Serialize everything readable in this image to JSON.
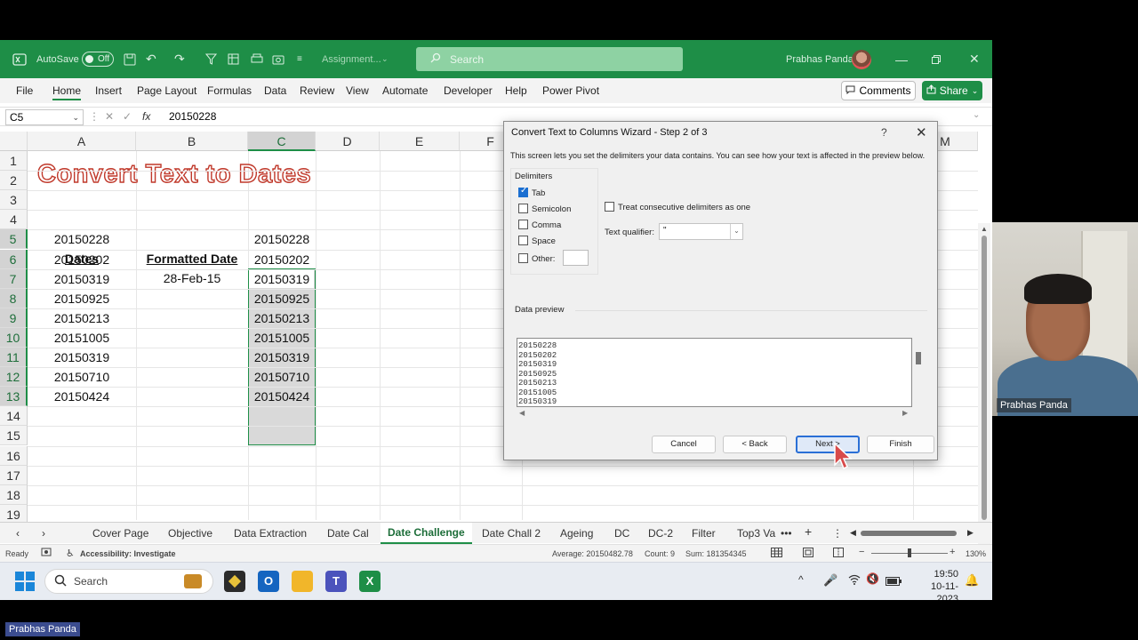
{
  "titlebar": {
    "autosave_label": "AutoSave",
    "autosave_state": "Off",
    "doc_name": "Assignment...",
    "search_placeholder": "Search",
    "user_name": "Prabhas Panda"
  },
  "menu": {
    "items": [
      "File",
      "Home",
      "Insert",
      "Page Layout",
      "Formulas",
      "Data",
      "Review",
      "View",
      "Automate",
      "Developer",
      "Help",
      "Power Pivot"
    ],
    "active": "Home",
    "comments_label": "Comments",
    "share_label": "Share"
  },
  "formulabar": {
    "cell_ref": "C5",
    "fx_label": "fx",
    "value": "20150228"
  },
  "grid": {
    "columns": [
      "A",
      "B",
      "C",
      "D",
      "E",
      "F",
      "M"
    ],
    "rows": [
      "1",
      "2",
      "3",
      "4",
      "5",
      "6",
      "7",
      "8",
      "9",
      "10",
      "11",
      "12",
      "13",
      "14",
      "15",
      "16",
      "17",
      "18",
      "19"
    ],
    "title": "Convert Text to Dates",
    "header_a": "Dates",
    "header_b": "Formatted Date",
    "col_a": [
      "20150228",
      "20150202",
      "20150319",
      "20150925",
      "20150213",
      "20151005",
      "20150319",
      "20150710",
      "20150424"
    ],
    "b5": "28-Feb-15",
    "col_c": [
      "20150228",
      "20150202",
      "20150319",
      "20150925",
      "20150213",
      "20151005",
      "20150319",
      "20150710",
      "20150424"
    ]
  },
  "sheets": {
    "tabs": [
      "Cover Page",
      "Objective",
      "Data Extraction",
      "Date Cal",
      "Date Challenge",
      "Date Chall 2",
      "Ageing",
      "DC",
      "DC-2",
      "Filter",
      "Top3 Va"
    ],
    "active": "Date Challenge"
  },
  "status": {
    "ready": "Ready",
    "accessibility": "Accessibility: Investigate",
    "average": "Average: 20150482.78",
    "count": "Count: 9",
    "sum": "Sum: 181354345",
    "zoom": "130%"
  },
  "taskbar": {
    "search_label": "Search",
    "time": "19:50",
    "date": "10-11-2023"
  },
  "dialog": {
    "title": "Convert Text to Columns Wizard - Step 2 of 3",
    "help": "?",
    "description": "This screen lets you set the delimiters your data contains.  You can see how your text is affected in the preview below.",
    "delimiters_label": "Delimiters",
    "options": [
      {
        "label": "Tab",
        "checked": true
      },
      {
        "label": "Semicolon",
        "checked": false
      },
      {
        "label": "Comma",
        "checked": false
      },
      {
        "label": "Space",
        "checked": false
      },
      {
        "label": "Other:",
        "checked": false
      }
    ],
    "consecutive_label": "Treat consecutive delimiters as one",
    "qualifier_label": "Text qualifier:",
    "qualifier_value": "\"",
    "preview_label": "Data preview",
    "preview_lines": [
      "20150228",
      "20150202",
      "20150319",
      "20150925",
      "20150213",
      "20151005",
      "20150319"
    ],
    "buttons": {
      "cancel": "Cancel",
      "back": "< Back",
      "next": "Next >",
      "finish": "Finish"
    }
  },
  "webcam": {
    "name": "Prabhas Panda"
  },
  "bottom_label": "Prabhas Panda",
  "colors": {
    "excel_green": "#1e8e47",
    "title_outline": "#c0392b",
    "primary_button": "#2a6fd6"
  }
}
